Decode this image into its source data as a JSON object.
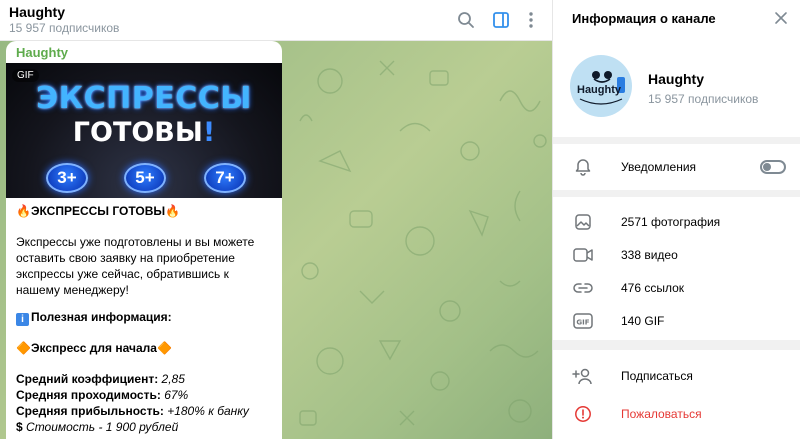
{
  "chat_header": {
    "title": "Haughty",
    "subscribers": "15 957 подписчиков",
    "icons": [
      "search-icon",
      "sidebar-toggle-icon",
      "more-vertical-icon"
    ]
  },
  "message": {
    "author": "Haughty",
    "gif_badge": "GIF",
    "banner": {
      "line1": "ЭКСПРЕССЫ",
      "line2": "ГОТОВЫ",
      "line2_suffix": "!",
      "badges": [
        "3+",
        "5+",
        "7+"
      ]
    },
    "heading_emoji": "🔥",
    "heading": "ЭКСПРЕССЫ ГОТОВЫ",
    "body": "Экспрессы уже подготовлены и вы можете оставить свою заявку на приобретение экспрессы уже сейчас, обратившись к нашему менеджеру!",
    "info_emoji": "i",
    "info_title": "Полезная информация:",
    "diamond_emoji": "🔶",
    "express_title": "Экспресс для начала",
    "stats": [
      {
        "label": "Средний коэффициент:",
        "value": "2,85"
      },
      {
        "label": "Средняя проходимость:",
        "value": "67%"
      },
      {
        "label": "Средняя прибыльность:",
        "value": "+180% к банку"
      }
    ],
    "price_icon": "$",
    "price": "Стоимость - 1 900 рублей"
  },
  "info_panel": {
    "title": "Информация о канале",
    "channel_name": "Haughty",
    "channel_subscribers": "15 957 подписчиков",
    "avatar_text": "Haughty",
    "notifications_label": "Уведомления",
    "notifications_enabled": false,
    "media": [
      {
        "icon": "photo-icon",
        "label": "2571 фотография"
      },
      {
        "icon": "video-icon",
        "label": "338 видео"
      },
      {
        "icon": "link-icon",
        "label": "476 ссылок"
      },
      {
        "icon": "gif-icon",
        "label": "140 GIF"
      }
    ],
    "subscribe_label": "Подписаться",
    "report_label": "Пожаловаться"
  },
  "colors": {
    "accent": "#3390ec",
    "author": "#5eab4c",
    "danger": "#e53935",
    "muted": "#8a959e"
  }
}
